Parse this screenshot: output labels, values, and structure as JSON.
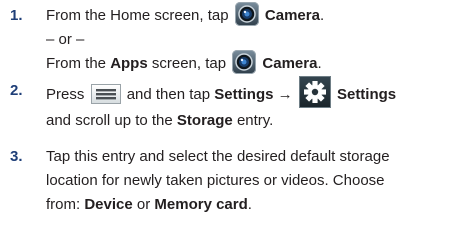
{
  "steps": [
    {
      "number": "1.",
      "line1_prefix": "From the Home screen, tap",
      "line1_bold": "Camera",
      "line1_suffix": ".",
      "or_text": "– or –",
      "line3_prefix": "From the",
      "line3_bold1": "Apps",
      "line3_middle": "screen, tap",
      "line3_bold2": "Camera",
      "line3_suffix": "."
    },
    {
      "number": "2.",
      "line1_prefix": "Press",
      "line1_middle": "and then tap",
      "line1_bold1": "Settings →",
      "line1_bold2": "Settings",
      "line2_prefix": "and scroll up to the",
      "line2_bold": "Storage",
      "line2_suffix": "entry."
    },
    {
      "number": "3.",
      "line1": "Tap this entry and select the desired default storage",
      "line2": "location for newly taken pictures or videos. Choose",
      "line3_prefix": "from:",
      "line3_bold1": "Device",
      "line3_middle": "or",
      "line3_bold2": "Memory card",
      "line3_suffix": "."
    }
  ],
  "icons": {
    "camera": "camera-icon",
    "menu": "menu-icon",
    "settings": "settings-gear-icon"
  }
}
